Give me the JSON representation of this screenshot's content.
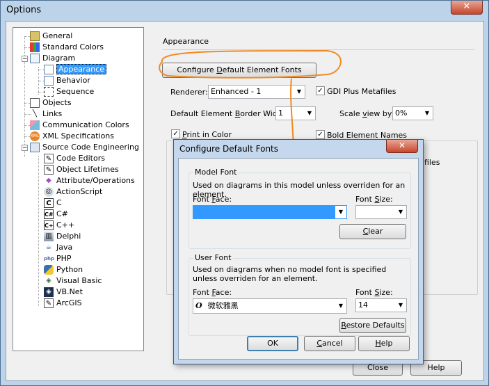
{
  "window": {
    "title": "Options",
    "close_glyph": "✕"
  },
  "tree": {
    "items": [
      {
        "label": "General",
        "icon": "general-icon"
      },
      {
        "label": "Standard Colors",
        "icon": "colors-icon"
      },
      {
        "label": "Diagram",
        "icon": "diagram-icon"
      },
      {
        "label": "Appearance",
        "icon": "appearance-icon"
      },
      {
        "label": "Behavior",
        "icon": "behavior-icon"
      },
      {
        "label": "Sequence",
        "icon": "sequence-icon"
      },
      {
        "label": "Objects",
        "icon": "objects-icon"
      },
      {
        "label": "Links",
        "icon": "links-icon"
      },
      {
        "label": "Communication Colors",
        "icon": "communication-colors-icon"
      },
      {
        "label": "XML Specifications",
        "icon": "xml-icon"
      },
      {
        "label": "Source Code Engineering",
        "icon": "source-code-icon"
      },
      {
        "label": "Code Editors",
        "icon": "code-editors-icon"
      },
      {
        "label": "Object Lifetimes",
        "icon": "object-lifetimes-icon"
      },
      {
        "label": "Attribute/Operations",
        "icon": "attribute-operations-icon"
      },
      {
        "label": "ActionScript",
        "icon": "actionscript-icon"
      },
      {
        "label": "C",
        "icon": "c-icon"
      },
      {
        "label": "C#",
        "icon": "csharp-icon"
      },
      {
        "label": "C++",
        "icon": "cpp-icon"
      },
      {
        "label": "Delphi",
        "icon": "delphi-icon"
      },
      {
        "label": "Java",
        "icon": "java-icon"
      },
      {
        "label": "PHP",
        "icon": "php-icon"
      },
      {
        "label": "Python",
        "icon": "python-icon"
      },
      {
        "label": "Visual Basic",
        "icon": "visual-basic-icon"
      },
      {
        "label": "VB.Net",
        "icon": "vbnet-icon"
      },
      {
        "label": "ArcGIS",
        "icon": "arcgis-icon"
      }
    ],
    "icon_glyphs": {
      "c": "C",
      "cs": "C#",
      "cpp": "C+",
      "php": "php",
      "xml": "XML"
    },
    "expander_minus": "−"
  },
  "appearance": {
    "section_title": "Appearance",
    "configure_button": {
      "pre": "Configure ",
      "key": "D",
      "post": "efault Element Fonts"
    },
    "renderer_label": "Renderer:",
    "renderer_value": "Enhanced - 1",
    "gdi_label": "GDI Plus Metafiles",
    "border_width_label": {
      "pre": "Default Element ",
      "key": "B",
      "post": "order Width:"
    },
    "border_width_value": "1",
    "scale_label": {
      "pre": "Scale ",
      "key": "v",
      "post": "iew by:"
    },
    "scale_value": "0%",
    "print_color_label": {
      "key": "P",
      "post": "rint in Color"
    },
    "bold_names_label": "Bold Element Names",
    "hidden_suffix": "files",
    "check_glyph": "✓",
    "arrow_glyph": "▼"
  },
  "footer": {
    "close_label": "Close",
    "help_label": "Help"
  },
  "dialog": {
    "title": "Configure Default Fonts",
    "close_glyph": "✕",
    "model_font": {
      "group_label": "Model Font",
      "description": "Used on diagrams in this model unless overriden for an element.",
      "face_label": {
        "pre": "Font ",
        "key": "F",
        "post": "ace:"
      },
      "size_label": {
        "pre": "Font ",
        "key": "S",
        "post": "ize:"
      },
      "face_value": "",
      "size_value": "",
      "clear_label": {
        "key": "C",
        "post": "lear"
      }
    },
    "user_font": {
      "group_label": "User Font",
      "description": "Used on diagrams when no model font is specified unless overriden for an element.",
      "face_label": {
        "pre": "Font ",
        "key": "F",
        "post": "ace:"
      },
      "size_label": {
        "pre": "Font ",
        "key": "S",
        "post": "ize:"
      },
      "face_icon_glyph": "O",
      "face_value": "微软雅黑",
      "size_value": "14",
      "restore_label": {
        "pre": "",
        "key": "R",
        "post": "estore Defaults"
      }
    },
    "ok_label": "OK",
    "cancel_label": {
      "key": "C",
      "post": "ancel"
    },
    "help_label": {
      "key": "H",
      "post": "elp"
    }
  },
  "colors": {
    "selection": "#3399ff",
    "annotation": "#f08a24",
    "titlebar": "#bcd3ea"
  }
}
